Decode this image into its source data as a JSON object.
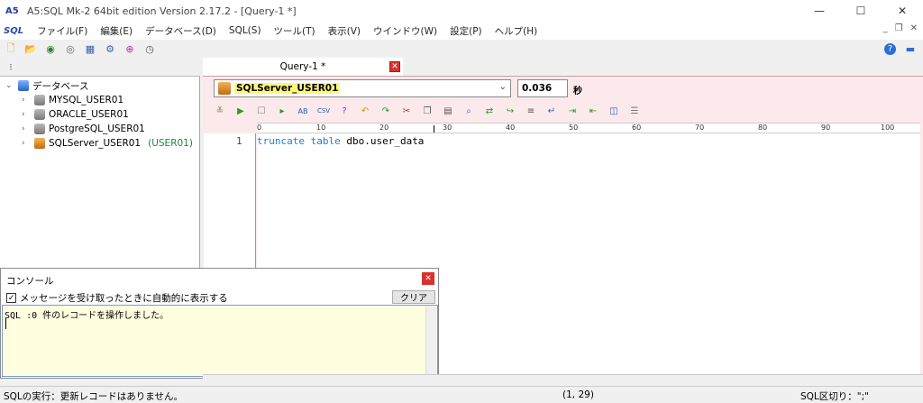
{
  "window": {
    "title": "A5:SQL Mk-2 64bit edition Version 2.17.2 - [Query-1 *]",
    "app_icon_text": "A5",
    "controls": [
      "—",
      "☐",
      "✕"
    ]
  },
  "menubar": {
    "logo": "SQL",
    "items": [
      "ファイル(F)",
      "編集(E)",
      "データベース(D)",
      "SQL(S)",
      "ツール(T)",
      "表示(V)",
      "ウインドウ(W)",
      "設定(P)",
      "ヘルプ(H)"
    ],
    "mdi_controls": [
      "_",
      "❐",
      "✕"
    ]
  },
  "tree": {
    "root_label": "データベース",
    "items": [
      {
        "label": "MYSQL_USER01",
        "tag": ""
      },
      {
        "label": "ORACLE_USER01",
        "tag": ""
      },
      {
        "label": "PostgreSQL_USER01",
        "tag": ""
      },
      {
        "label": "SQLServer_USER01",
        "tag": "(USER01)"
      }
    ]
  },
  "editor": {
    "tab_label": "Query-1 *",
    "connection": "SQLServer_USER01",
    "elapsed": "0.036",
    "elapsed_unit": "秒",
    "line_number": "1",
    "code_keyword": "truncate table",
    "code_rest": " dbo.user_data",
    "ruler_numbers": [
      "0",
      "10",
      "20",
      "30",
      "40",
      "50",
      "60",
      "70",
      "80",
      "90",
      "100"
    ]
  },
  "console": {
    "title": "コンソール",
    "checkbox_label": "メッセージを受け取ったときに自動的に表示する",
    "checked": true,
    "clear_label": "クリア",
    "log": "SQL :0 件のレコードを操作しました。"
  },
  "statusbar": {
    "message": "SQLの実行：更新レコードはありません。",
    "position": "(1, 29)",
    "separator": "SQL区切り：\";\""
  }
}
